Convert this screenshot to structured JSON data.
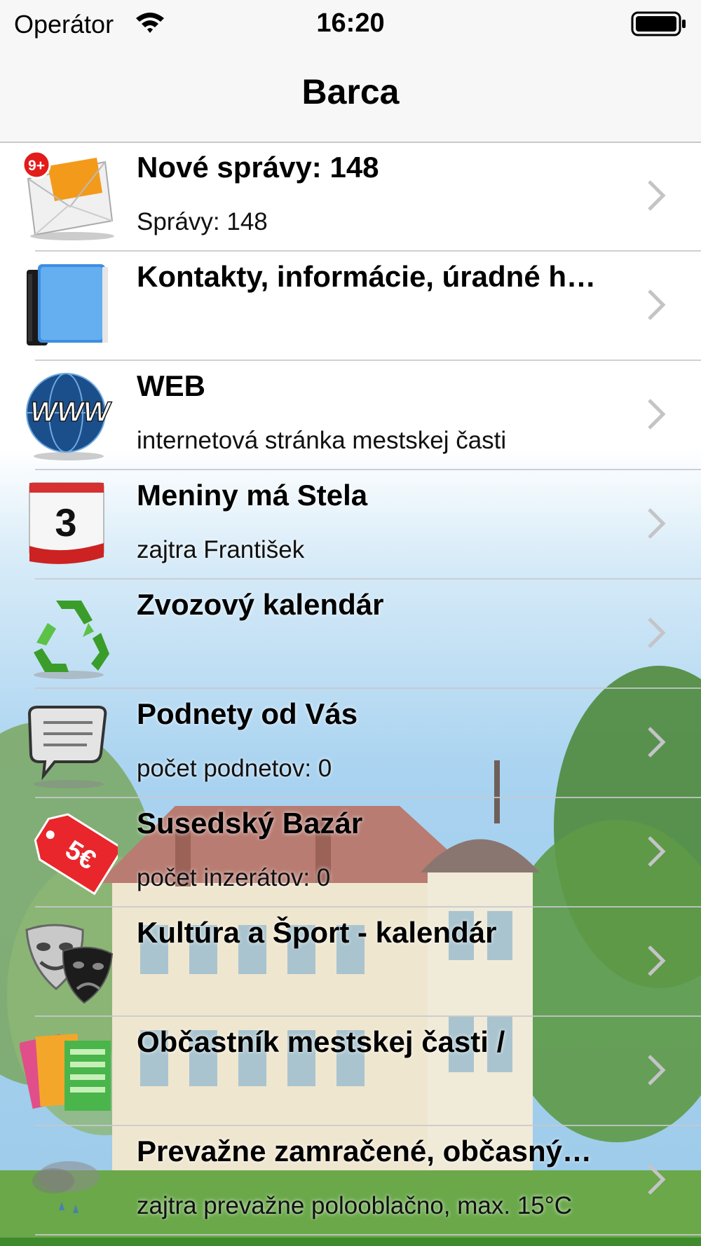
{
  "status": {
    "carrier": "Operátor",
    "time": "16:20"
  },
  "nav": {
    "title": "Barca"
  },
  "rows": [
    {
      "title": "Nové správy: 148",
      "subtitle": "Správy: 148",
      "icon": "mail-icon",
      "badge": "9+"
    },
    {
      "title": "Kontakty, informácie, úradné h…",
      "subtitle": "",
      "icon": "address-book-icon"
    },
    {
      "title": "WEB",
      "subtitle": "internetová stránka mestskej časti",
      "icon": "www-globe-icon",
      "icon_text": "WWW"
    },
    {
      "title": "Meniny má Stela",
      "subtitle": "zajtra František",
      "icon": "calendar-icon",
      "icon_text": "3"
    },
    {
      "title": "Zvozový kalendár",
      "subtitle": "",
      "icon": "recycle-icon"
    },
    {
      "title": "Podnety od Vás",
      "subtitle": "počet podnetov: 0",
      "icon": "speech-bubble-icon"
    },
    {
      "title": "Susedský Bazár",
      "subtitle": "počet inzerátov: 0",
      "icon": "price-tag-icon",
      "icon_text": "5€"
    },
    {
      "title": "Kultúra a Šport - kalendár",
      "subtitle": "",
      "icon": "theatre-masks-icon"
    },
    {
      "title": "Občastník mestskej časti /",
      "subtitle": "",
      "icon": "magazine-icon"
    },
    {
      "title": "Prevažne zamračené, občasný…",
      "subtitle": "zajtra prevažne polooblačno, max. 15°C",
      "icon": "weather-icon"
    }
  ],
  "colors": {
    "nav_bg": "#f7f7f7",
    "badge": "#e21b1b",
    "chevron": "#c4c4c7",
    "grass": "#3f8a2c"
  }
}
